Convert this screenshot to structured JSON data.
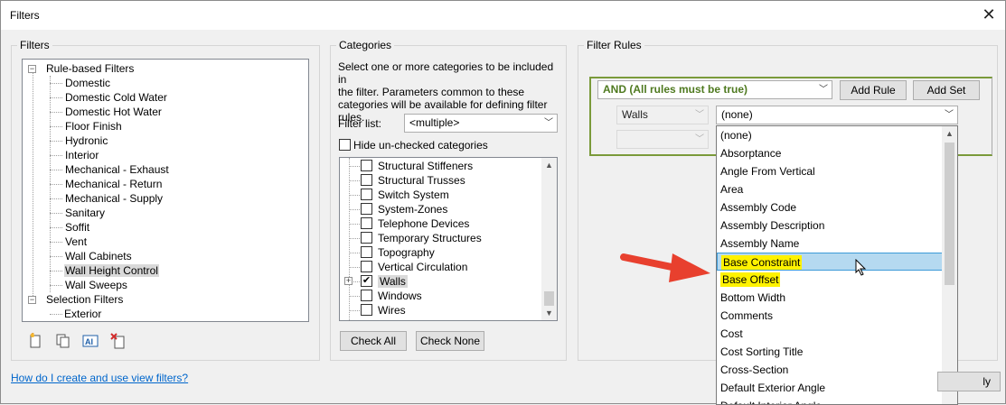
{
  "window": {
    "title": "Filters",
    "close": "✕"
  },
  "filters": {
    "group_label": "Filters",
    "root_rule": "Rule-based Filters",
    "rule_items": [
      "Domestic",
      "Domestic Cold Water",
      "Domestic Hot Water",
      "Floor Finish",
      "Hydronic",
      "Interior",
      "Mechanical - Exhaust",
      "Mechanical - Return",
      "Mechanical - Supply",
      "Sanitary",
      "Soffit",
      "Vent",
      "Wall Cabinets",
      "Wall Height Control",
      "Wall Sweeps"
    ],
    "selected": "Wall Height Control",
    "root_selection": "Selection Filters",
    "selection_items": [
      "Exterior"
    ],
    "icons": [
      "new-filter-icon",
      "duplicate-filter-icon",
      "rename-filter-icon",
      "delete-filter-icon"
    ]
  },
  "categories": {
    "group_label": "Categories",
    "description": [
      "Select one or more categories to be included in",
      "the filter.  Parameters common to these",
      "categories will be available for defining filter rules."
    ],
    "filter_list_label": "Filter list:",
    "filter_list_value": "<multiple>",
    "hide_unchecked_label": "Hide un-checked categories",
    "items": [
      {
        "label": "Structural Stiffeners",
        "checked": false
      },
      {
        "label": "Structural Trusses",
        "checked": false
      },
      {
        "label": "Switch System",
        "checked": false
      },
      {
        "label": "System-Zones",
        "checked": false
      },
      {
        "label": "Telephone Devices",
        "checked": false
      },
      {
        "label": "Temporary Structures",
        "checked": false
      },
      {
        "label": "Topography",
        "checked": false
      },
      {
        "label": "Vertical Circulation",
        "checked": false
      },
      {
        "label": "Walls",
        "checked": true
      },
      {
        "label": "Windows",
        "checked": false
      },
      {
        "label": "Wires",
        "checked": false
      }
    ],
    "check_all": "Check All",
    "check_none": "Check None"
  },
  "rules": {
    "group_label": "Filter Rules",
    "logic": "AND (All rules must be true)",
    "add_rule": "Add Rule",
    "add_set": "Add Set",
    "category": "Walls",
    "parameter": "(none)",
    "dropdown_items": [
      "(none)",
      "Absorptance",
      "Angle From Vertical",
      "Area",
      "Assembly Code",
      "Assembly Description",
      "Assembly Name",
      "Base Constraint",
      "Base Offset",
      "Bottom Width",
      "Comments",
      "Cost",
      "Cost Sorting Title",
      "Cross-Section",
      "Default Exterior Angle",
      "Default Interior Angle"
    ],
    "hover_item": "Base Constraint",
    "highlighted_items": [
      "Base Constraint",
      "Base Offset"
    ],
    "apply_fragment": "ly"
  },
  "help_link": "How do I create and use view filters?",
  "colors": {
    "accent_border": "#7a9a3a",
    "hover_bg": "#b5d9f0",
    "highlight": "#fff200",
    "arrow": "#e8402e"
  }
}
